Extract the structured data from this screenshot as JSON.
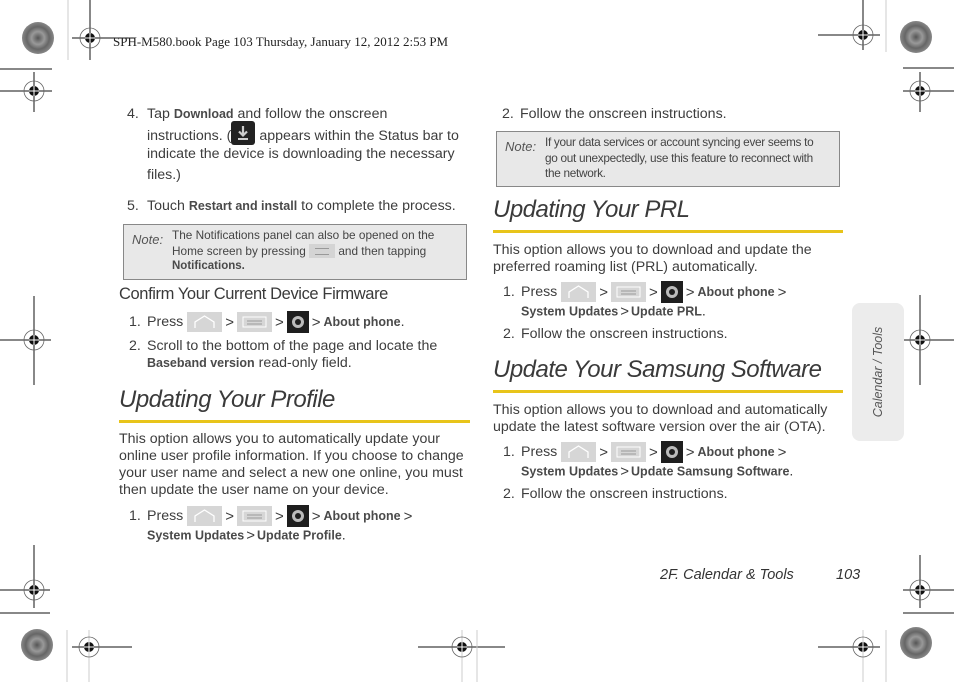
{
  "header": {
    "print_line": "SPH-M580.book  Page 103  Thursday, January 12, 2012  2:53 PM"
  },
  "left": {
    "step4": {
      "number": "4.",
      "pre": "Tap ",
      "bold": "Download",
      "line1_rest": " and follow the onscreen",
      "line2_pre": "instructions. (",
      "line2_post": " appears within the Status bar to",
      "line3": "indicate the device is downloading the necessary",
      "line4": "files.)",
      "icon": "download-icon"
    },
    "step5": {
      "number": "5.",
      "pre": "Touch ",
      "bold": "Restart and install",
      "post": " to complete the process."
    },
    "note1": {
      "label": "Note:",
      "line1": "The Notifications panel can also be opened on the",
      "line2_pre": "Home screen by pressing ",
      "line2_post": " and then tapping",
      "line3_bold": "Notifications."
    },
    "firmware": {
      "heading": "Confirm Your Current Device Firmware",
      "step1": {
        "number": "1.",
        "pre": "Press",
        "sep": ">",
        "bold": "About phone",
        "end": "."
      },
      "step2": {
        "number": "2.",
        "line1": "Scroll to the bottom of the page and locate the",
        "bold": "Baseband version",
        "post": " read-only field."
      }
    },
    "profile": {
      "heading": "Updating Your Profile",
      "para": [
        "This option allows you to automatically update your",
        "online user profile information. If you choose to change",
        "your user name and select a new one online, you must",
        "then update the user name on your device."
      ],
      "step1": {
        "number": "1.",
        "pre": "Press",
        "sep": ">",
        "bold1": "About phone",
        "bold2": "System Updates",
        "bold3": "Update Profile",
        "end": "."
      }
    }
  },
  "right": {
    "step2_top": {
      "number": "2.",
      "text": "Follow the onscreen instructions."
    },
    "note2": {
      "label": "Note:",
      "line1": "If your data services or account syncing ever seems to",
      "line2": "go out unexpectedly, use this feature to reconnect with",
      "line3": "the network."
    },
    "prl": {
      "heading": "Updating Your PRL",
      "para": [
        "This option allows you to download and update the",
        "preferred roaming list (PRL) automatically."
      ],
      "step1": {
        "number": "1.",
        "pre": "Press",
        "sep": ">",
        "bold1": "About phone",
        "bold2": "System Updates",
        "bold3": "Update PRL",
        "end": "."
      },
      "step2": {
        "number": "2.",
        "text": "Follow the onscreen instructions."
      }
    },
    "samsung": {
      "heading": "Update Your Samsung Software",
      "para": [
        "This option allows you to download and automatically",
        "update the latest software version over the air (OTA)."
      ],
      "step1": {
        "number": "1.",
        "pre": "Press",
        "sep": ">",
        "bold1": "About phone",
        "bold2": "System Updates",
        "bold3": "Update Samsung Software",
        "end": "."
      },
      "step2": {
        "number": "2.",
        "text": "Follow the onscreen instructions."
      }
    }
  },
  "side_tab": {
    "label": "Calendar / Tools"
  },
  "footer": {
    "section": "2F. Calendar & Tools",
    "page": "103"
  },
  "colors": {
    "accent_rule": "#e8c41a",
    "note_bg": "#e8e8e8",
    "tab_bg": "#ececec"
  }
}
